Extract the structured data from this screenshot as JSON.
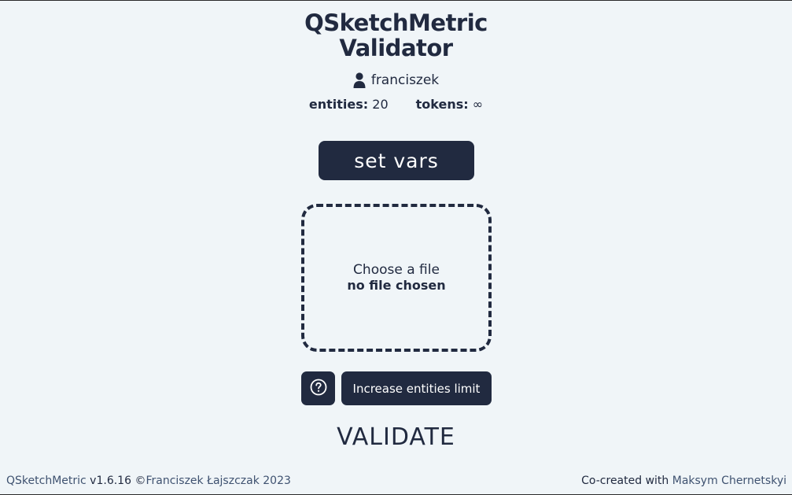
{
  "app": {
    "title_line1": "QSketchMetric",
    "title_line2": "Validator"
  },
  "user": {
    "name": "franciszek",
    "icon": "user-icon"
  },
  "stats": {
    "entities_label": "entities:",
    "entities_value": "20",
    "tokens_label": "tokens:",
    "tokens_value": "∞"
  },
  "actions": {
    "set_vars_label": "set vars",
    "increase_limit_label": "Increase entities limit",
    "help_icon": "question-circle-icon",
    "validate_label": "VALIDATE"
  },
  "file_input": {
    "prompt": "Choose a file",
    "status": "no file chosen"
  },
  "footer": {
    "brand": "QSketchMetric",
    "version": "v1.6.16",
    "copyright_symbol": "©",
    "author": "Franciszek Łajszczak 2023",
    "cocreated_text": "Co-created with",
    "cocreator": "Maksym Chernetskyi"
  },
  "colors": {
    "background": "#f0f5f8",
    "primary": "#212a40",
    "link": "#3f5270"
  }
}
